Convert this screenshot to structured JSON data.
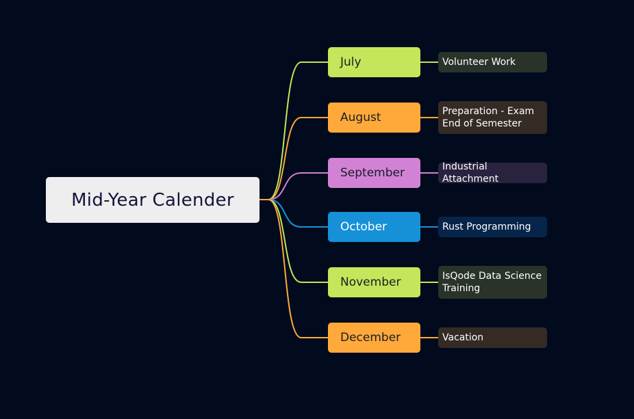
{
  "root": {
    "label": "Mid-Year Calender"
  },
  "colors": {
    "background": "#020b1d",
    "root_fill": "#eeeeef",
    "lime": "#c4e65a",
    "orange": "#ffa93a",
    "violet": "#d282d5",
    "blue": "#1691d7"
  },
  "branches": [
    {
      "month": "July",
      "note": "Volunteer Work",
      "color": "#c4e65a",
      "text_color": "#1c1c28",
      "note_bg": "#293329"
    },
    {
      "month": "August",
      "note": "Preparation - Exam\nEnd of Semester",
      "color": "#ffa93a",
      "text_color": "#1c1c28",
      "note_bg": "#342b25"
    },
    {
      "month": "September",
      "note": "Industrial Attachment",
      "color": "#d282d5",
      "text_color": "#1c1c28",
      "note_bg": "#2a2340"
    },
    {
      "month": "October",
      "note": "Rust Programming",
      "color": "#1691d7",
      "text_color": "#ffffff",
      "note_bg": "#07254a"
    },
    {
      "month": "November",
      "note": "IsQode Data Science\nTraining",
      "color": "#c4e65a",
      "text_color": "#1c1c28",
      "note_bg": "#293329"
    },
    {
      "month": "December",
      "note": "Vacation",
      "color": "#ffa93a",
      "text_color": "#1c1c28",
      "note_bg": "#342b25"
    }
  ]
}
